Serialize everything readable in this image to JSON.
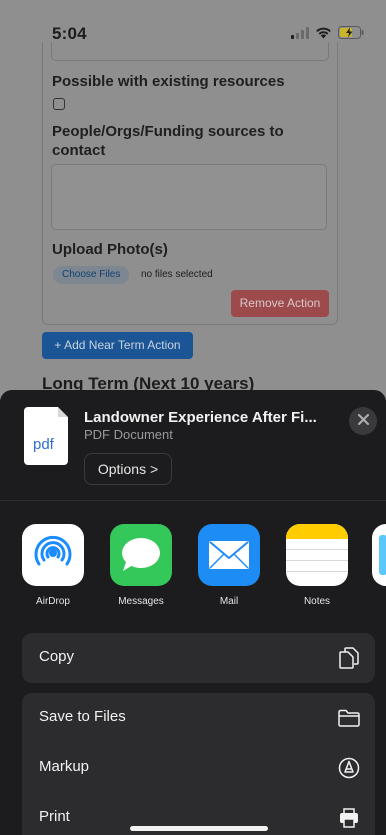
{
  "status_bar": {
    "time": "5:04",
    "signal_icon": "cellular-signal-icon",
    "wifi_icon": "wifi-icon",
    "battery_icon": "battery-charging-icon"
  },
  "background_page": {
    "checkbox_label": "Possible with existing resources",
    "contacts_label": "People/Orgs/Funding sources to contact",
    "upload_label": "Upload Photo(s)",
    "choose_files_label": "Choose Files",
    "no_files_text": "no files selected",
    "remove_action_label": "Remove Action",
    "add_action_label": "+ Add Near Term Action",
    "section_heading": "Long Term (Next 10 years)"
  },
  "share_sheet": {
    "document": {
      "thumb_label": "pdf",
      "title": "Landowner Experience After Fi...",
      "subtitle": "PDF Document"
    },
    "options_label": "Options >",
    "apps": [
      {
        "label": "AirDrop",
        "icon": "airdrop-icon"
      },
      {
        "label": "Messages",
        "icon": "messages-icon"
      },
      {
        "label": "Mail",
        "icon": "mail-icon"
      },
      {
        "label": "Notes",
        "icon": "notes-icon"
      }
    ],
    "actions_primary": [
      {
        "label": "Copy",
        "icon": "copy-icon"
      }
    ],
    "actions_secondary": [
      {
        "label": "Save to Files",
        "icon": "folder-icon"
      },
      {
        "label": "Markup",
        "icon": "markup-icon"
      },
      {
        "label": "Print",
        "icon": "printer-icon"
      }
    ]
  },
  "colors": {
    "sheet_background": "#1c1c1e",
    "row_background": "#2c2c2e",
    "remove_button": "#dc3545",
    "add_button": "#0d6efd"
  }
}
